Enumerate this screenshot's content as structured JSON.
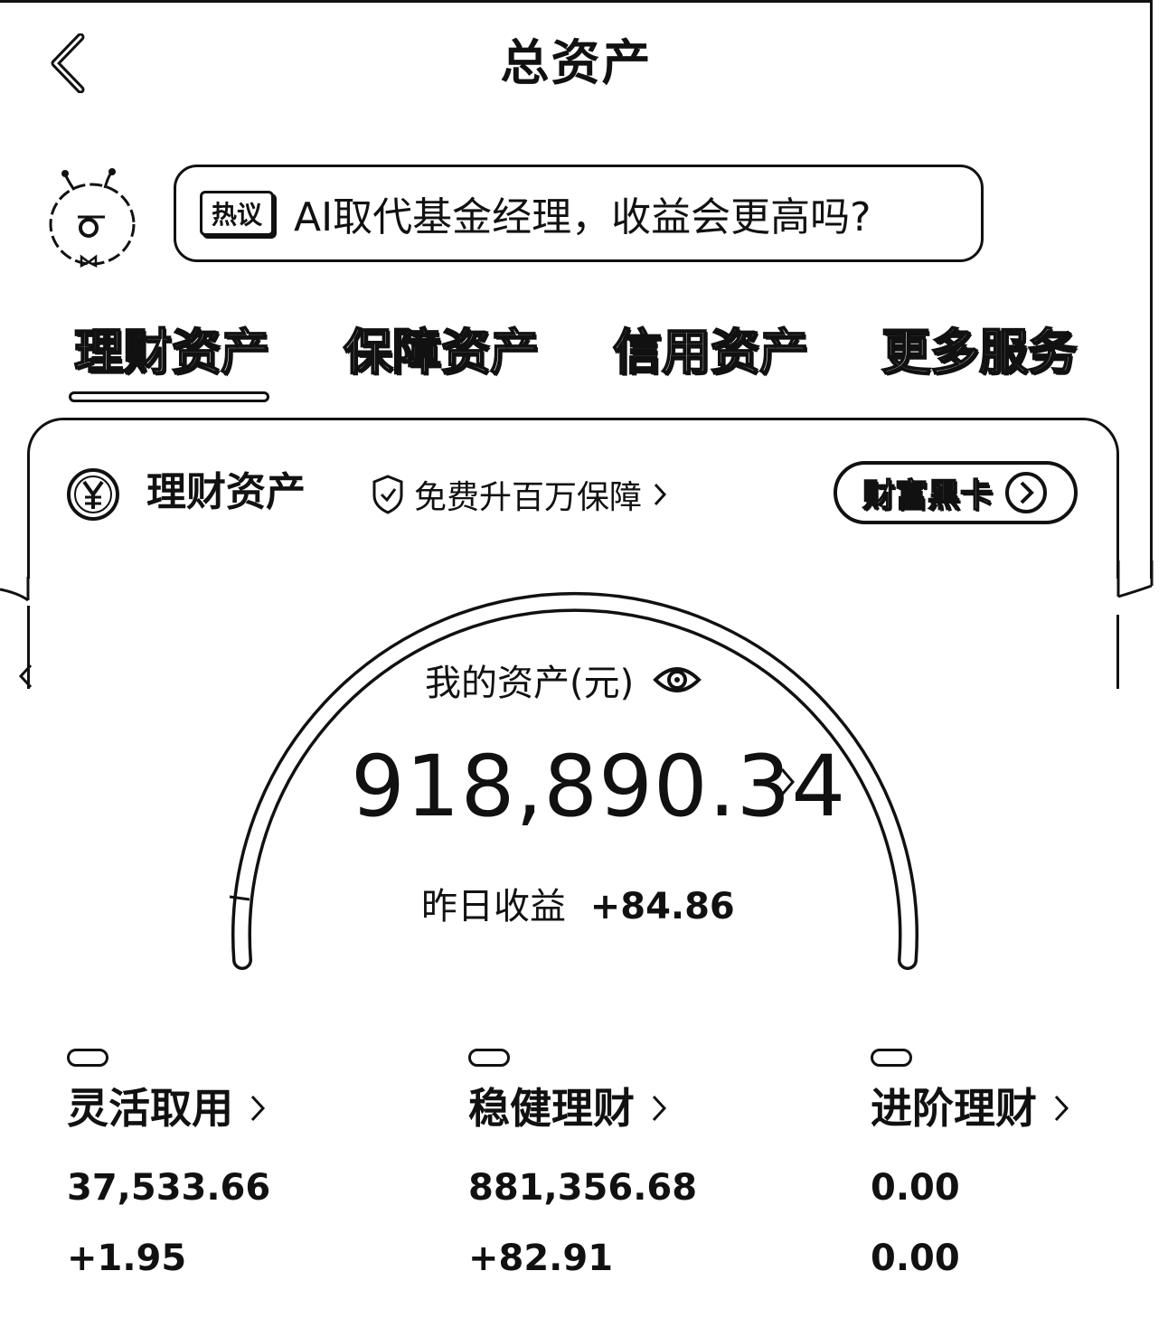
{
  "header": {
    "title": "总资产",
    "back_icon": "chevron-left-icon"
  },
  "ai_banner": {
    "tag": "热议",
    "text": "AI取代基金经理，收益会更高吗?"
  },
  "tabs": [
    {
      "label": "理财资产",
      "active": true
    },
    {
      "label": "保障资产",
      "active": false
    },
    {
      "label": "信用资产",
      "active": false
    },
    {
      "label": "更多服务",
      "active": false
    }
  ],
  "card": {
    "title": "理财资产",
    "promo": "免费升百万保障",
    "wealth_button": "财富黑卡"
  },
  "summary": {
    "assets_label": "我的资产(元)",
    "total": "918,890.34",
    "yesterday_label": "昨日收益",
    "yesterday_value": "+84.86"
  },
  "categories": [
    {
      "title": "灵活取用",
      "value": "37,533.66",
      "change": "+1.95"
    },
    {
      "title": "稳健理财",
      "value": "881,356.68",
      "change": "+82.91"
    },
    {
      "title": "进阶理财",
      "value": "0.00",
      "change": "0.00"
    }
  ]
}
